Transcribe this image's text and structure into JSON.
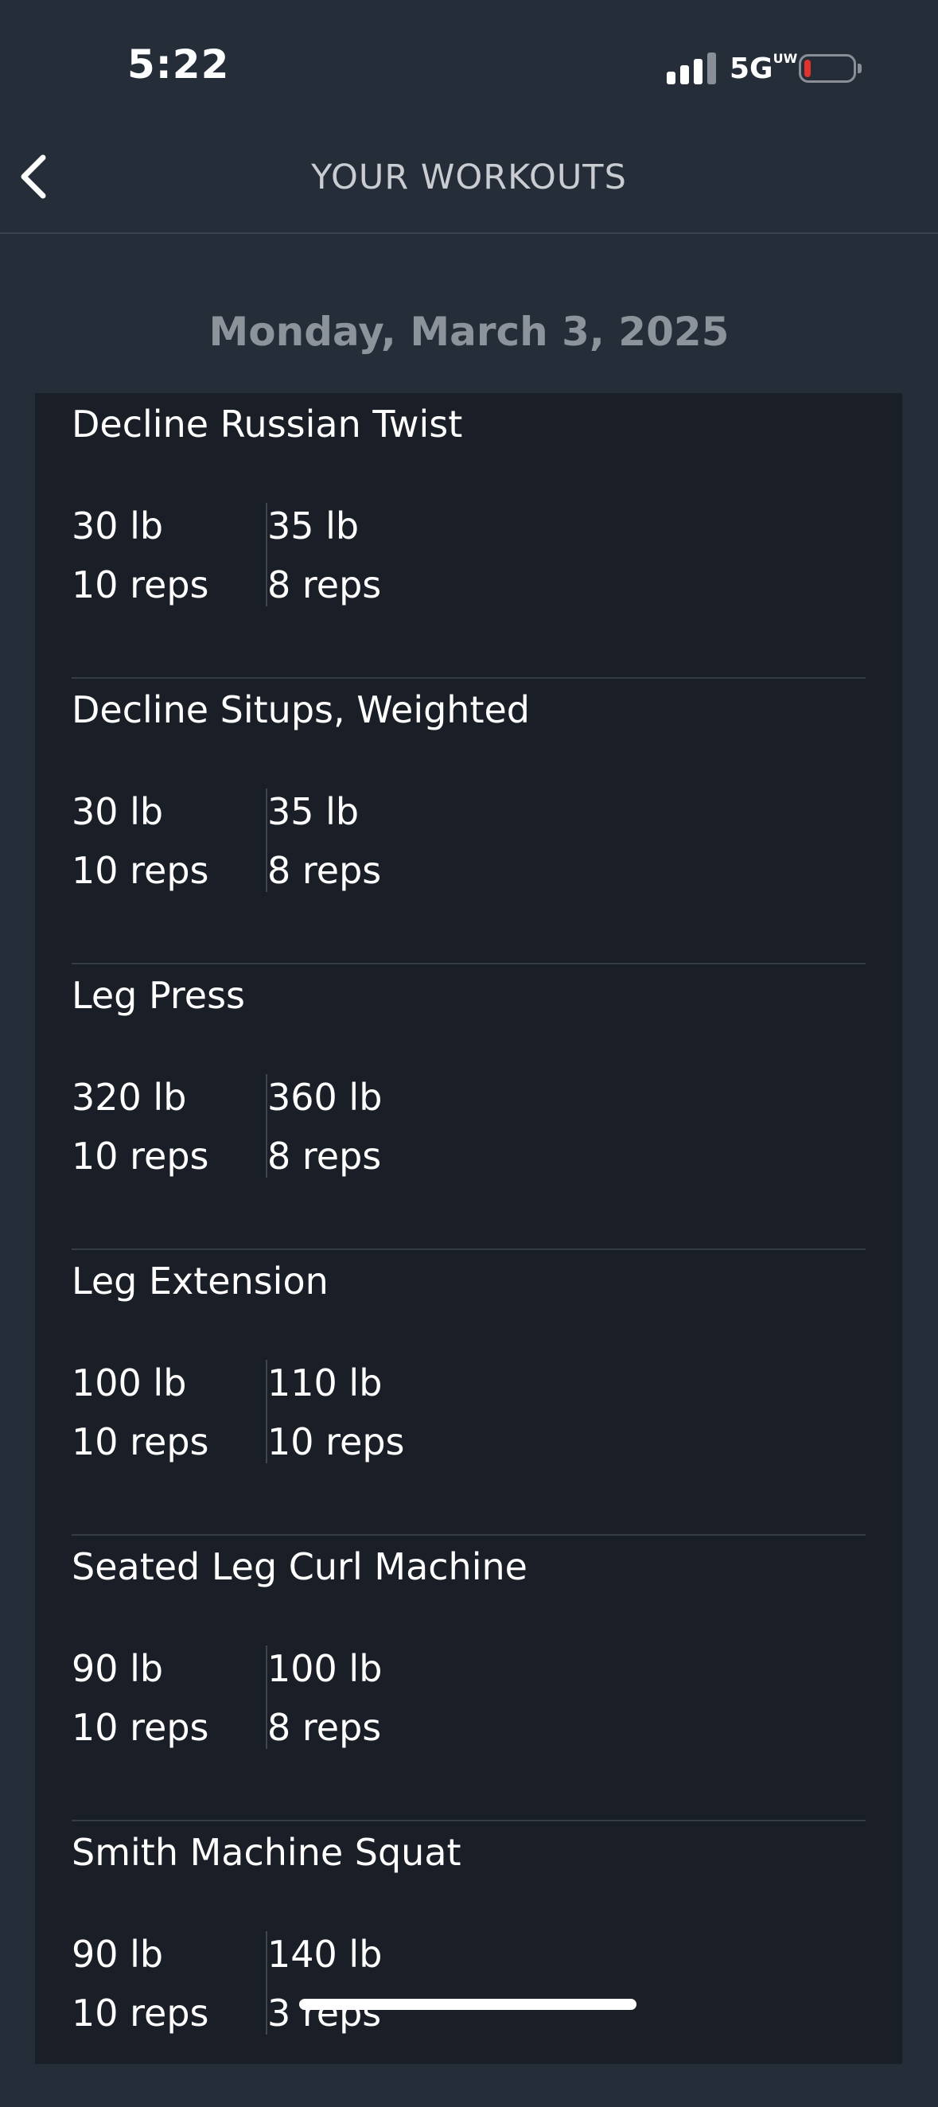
{
  "status_bar": {
    "time": "5:22",
    "network": "5G",
    "network_badge": "UW",
    "battery_status_color": "#e0332e"
  },
  "nav": {
    "back_icon": "chevron-left-icon",
    "title": "YOUR WORKOUTS"
  },
  "date": "Monday, March 3, 2025",
  "exercises": [
    {
      "name": "Decline Russian Twist",
      "sets": [
        {
          "weight": "30 lb",
          "reps": "10 reps"
        },
        {
          "weight": "35 lb",
          "reps": "8 reps"
        }
      ]
    },
    {
      "name": "Decline Situps, Weighted",
      "sets": [
        {
          "weight": "30 lb",
          "reps": "10 reps"
        },
        {
          "weight": "35 lb",
          "reps": "8 reps"
        }
      ]
    },
    {
      "name": "Leg Press",
      "sets": [
        {
          "weight": "320 lb",
          "reps": "10 reps"
        },
        {
          "weight": "360 lb",
          "reps": "8 reps"
        }
      ]
    },
    {
      "name": "Leg Extension",
      "sets": [
        {
          "weight": "100 lb",
          "reps": "10 reps"
        },
        {
          "weight": "110 lb",
          "reps": "10 reps"
        }
      ]
    },
    {
      "name": "Seated Leg Curl Machine",
      "sets": [
        {
          "weight": "90 lb",
          "reps": "10 reps"
        },
        {
          "weight": "100 lb",
          "reps": "8 reps"
        }
      ]
    },
    {
      "name": "Smith Machine Squat",
      "sets": [
        {
          "weight": "90 lb",
          "reps": "10 reps"
        },
        {
          "weight": "140 lb",
          "reps": "3 reps"
        }
      ]
    }
  ]
}
